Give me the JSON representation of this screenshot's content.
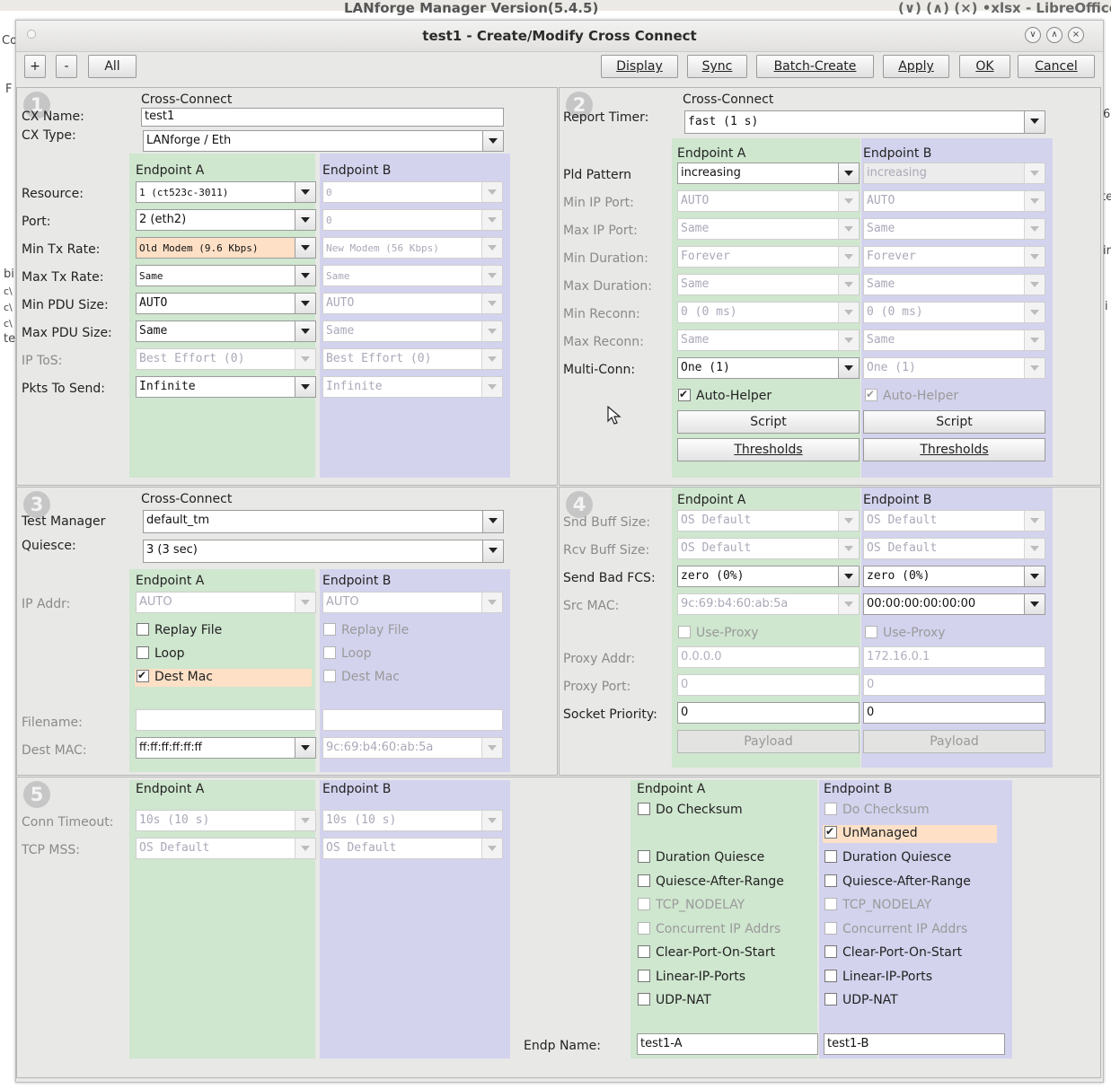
{
  "background": {
    "app_title": "LANforge Manager   Version(5.4.5)",
    "right_title": "(∨) (∧) (×) •xlsx - LibreOffice",
    "left_frags": [
      "Co",
      "F",
      "bi",
      "c\\",
      "c\\",
      "c\\",
      "te"
    ],
    "right_frags": [
      "6",
      "te",
      "ir",
      "i"
    ]
  },
  "window": {
    "title": "test1 - Create/Modify Cross Connect"
  },
  "toolbar": {
    "plus": "+",
    "minus": "-",
    "all": "All",
    "display": "Display",
    "sync": "Sync",
    "batch_create": "Batch-Create",
    "apply": "Apply",
    "ok": "OK",
    "cancel": "Cancel"
  },
  "p1": {
    "badge": "1",
    "cc_header": "Cross-Connect",
    "cx_name_label": "CX Name:",
    "cx_name_value": "test1",
    "cx_type_label": "CX Type:",
    "cx_type_value": "LANforge / Eth",
    "ep_a": "Endpoint A",
    "ep_b": "Endpoint B",
    "labels": [
      "Resource:",
      "Port:",
      "Min Tx Rate:",
      "Max Tx Rate:",
      "Min PDU Size:",
      "Max PDU Size:",
      "IP ToS:",
      "Pkts To Send:"
    ],
    "a": [
      "1 (ct523c-3011)",
      "2 (eth2)",
      "Old Modem (9.6 Kbps)",
      "Same",
      "AUTO",
      "Same",
      "Best Effort   (0)",
      "Infinite"
    ],
    "b": [
      "0",
      "0",
      "New Modem (56 Kbps)",
      "Same",
      "AUTO",
      "Same",
      "Best Effort   (0)",
      "Infinite"
    ]
  },
  "p2": {
    "badge": "2",
    "cc_header": "Cross-Connect",
    "report_timer_label": "Report Timer:",
    "report_timer_value": "fast     (1 s)",
    "ep_a": "Endpoint A",
    "ep_b": "Endpoint B",
    "labels": [
      "Pld Pattern",
      "Min IP Port:",
      "Max IP Port:",
      "Min Duration:",
      "Max Duration:",
      "Min Reconn:",
      "Max Reconn:",
      "Multi-Conn:"
    ],
    "a": [
      "increasing",
      "AUTO",
      "Same",
      "Forever",
      "Same",
      "0    (0 ms)",
      "Same",
      "One (1)"
    ],
    "b": [
      "increasing",
      "AUTO",
      "Same",
      "Forever",
      "Same",
      "0    (0 ms)",
      "Same",
      "One (1)"
    ],
    "auto_helper": "Auto-Helper",
    "script": "Script",
    "thresholds": "Thresholds"
  },
  "p3": {
    "badge": "3",
    "cc_header": "Cross-Connect",
    "test_manager_label": "Test Manager",
    "test_manager_value": "default_tm",
    "quiesce_label": "Quiesce:",
    "quiesce_value": "3 (3 sec)",
    "ep_a": "Endpoint A",
    "ep_b": "Endpoint B",
    "ip_addr_label": "IP Addr:",
    "ip_addr_a": "AUTO",
    "ip_addr_b": "AUTO",
    "replay_file": "Replay File",
    "loop": "Loop",
    "dest_mac": "Dest Mac",
    "filename_label": "Filename:",
    "dest_mac_label": "Dest MAC:",
    "dest_mac_a": "ff:ff:ff:ff:ff:ff",
    "dest_mac_b": "9c:69:b4:60:ab:5a"
  },
  "p4": {
    "badge": "4",
    "ep_a": "Endpoint A",
    "ep_b": "Endpoint B",
    "snd_buff_label": "Snd Buff Size:",
    "snd_buff_a": "OS Default",
    "snd_buff_b": "OS Default",
    "rcv_buff_label": "Rcv Buff Size:",
    "rcv_buff_a": "OS Default",
    "rcv_buff_b": "OS Default",
    "bad_fcs_label": "Send Bad FCS:",
    "bad_fcs_a": "zero (0%)",
    "bad_fcs_b": "zero (0%)",
    "src_mac_label": "Src MAC:",
    "src_mac_a": "9c:69:b4:60:ab:5a",
    "src_mac_b": "00:00:00:00:00:00",
    "use_proxy": "Use-Proxy",
    "proxy_addr_label": "Proxy Addr:",
    "proxy_addr_a": "0.0.0.0",
    "proxy_addr_b": "172.16.0.1",
    "proxy_port_label": "Proxy Port:",
    "proxy_port_a": "0",
    "proxy_port_b": "0",
    "socket_prio_label": "Socket Priority:",
    "socket_prio_a": "0",
    "socket_prio_b": "0",
    "payload": "Payload"
  },
  "p5": {
    "badge": "5",
    "ep_a": "Endpoint A",
    "ep_b": "Endpoint B",
    "conn_timeout_label": "Conn Timeout:",
    "conn_timeout_a": "10s     (10 s)",
    "conn_timeout_b": "10s     (10 s)",
    "tcp_mss_label": "TCP MSS:",
    "tcp_mss_a": "OS Default",
    "tcp_mss_b": "OS Default",
    "do_checksum": "Do Checksum",
    "unmanaged": "UnManaged",
    "duration_quiesce": "Duration Quiesce",
    "quiesce_after_range": "Quiesce-After-Range",
    "tcp_nodelay": "TCP_NODELAY",
    "concurrent_ip": "Concurrent IP Addrs",
    "clear_port": "Clear-Port-On-Start",
    "linear_ip": "Linear-IP-Ports",
    "udp_nat": "UDP-NAT",
    "endp_name_label": "Endp Name:",
    "endp_name_a": "test1-A",
    "endp_name_b": "test1-B"
  },
  "colors": {
    "endpoint_a_bg": "#cfe6cf",
    "endpoint_b_bg": "#d3d3ee",
    "highlight": "#fde0c6"
  }
}
